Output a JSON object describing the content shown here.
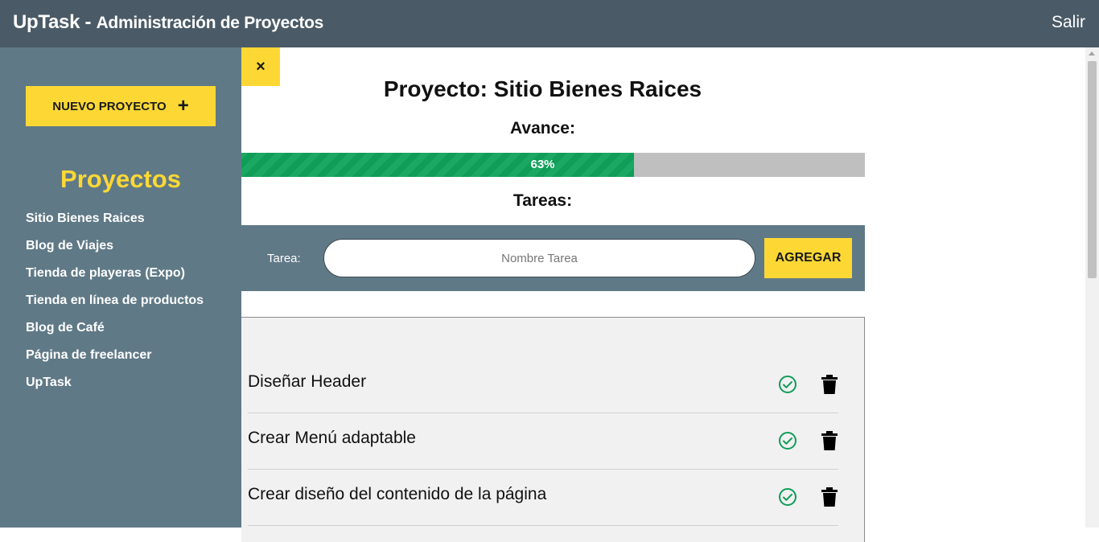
{
  "header": {
    "brand": "UpTask -",
    "subtitle": "Administración de Proyectos",
    "logout_label": "Salir"
  },
  "sidebar": {
    "new_project_label": "NUEVO PROYECTO",
    "new_project_icon": "plus-icon",
    "projects_title": "Proyectos",
    "projects": [
      "Sitio Bienes Raices",
      "Blog de Viajes",
      "Tienda de playeras (Expo)",
      "Tienda en línea de productos",
      "Blog de Café",
      "Página de freelancer",
      "UpTask"
    ]
  },
  "main": {
    "close_label": "×",
    "project_label": "Proyecto:",
    "project_name": "Sitio Bienes Raices",
    "progress_label": "Avance:",
    "progress_percent": 63,
    "progress_text": "63%",
    "tasks_label": "Tareas:",
    "form": {
      "label": "Tarea:",
      "placeholder": "Nombre Tarea",
      "value": "",
      "submit_label": "AGREGAR"
    },
    "tasks": [
      {
        "name": "Diseñar Header",
        "status": "complete"
      },
      {
        "name": "Crear Menú adaptable",
        "status": "complete"
      },
      {
        "name": "Crear diseño del contenido de la página",
        "status": "complete"
      }
    ]
  },
  "colors": {
    "topbar": "#4a5a66",
    "sidebar": "#607986",
    "accent": "#fdd835",
    "progress_fill": "#0f9d58",
    "progress_track": "#bfbfbf",
    "check": "#0f9d58"
  }
}
